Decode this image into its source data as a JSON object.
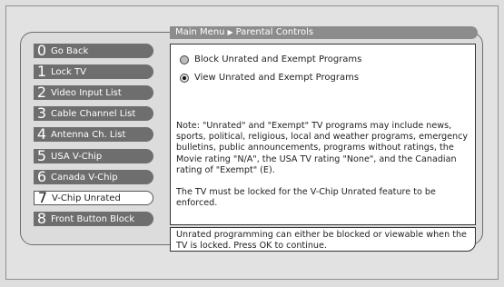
{
  "breadcrumb": {
    "parent": "Main Menu",
    "separator": "▶",
    "current": "Parental Controls"
  },
  "menu": [
    {
      "num": "0",
      "label": "Go Back",
      "selected": false
    },
    {
      "num": "1",
      "label": "Lock TV",
      "selected": false
    },
    {
      "num": "2",
      "label": "Video Input List",
      "selected": false
    },
    {
      "num": "3",
      "label": "Cable Channel List",
      "selected": false
    },
    {
      "num": "4",
      "label": "Antenna Ch. List",
      "selected": false
    },
    {
      "num": "5",
      "label": "USA V-Chip",
      "selected": false
    },
    {
      "num": "6",
      "label": "Canada V-Chip",
      "selected": false
    },
    {
      "num": "7",
      "label": "V-Chip Unrated",
      "selected": true
    },
    {
      "num": "8",
      "label": "Front Button Block",
      "selected": false
    }
  ],
  "options": [
    {
      "label": "Block Unrated and Exempt Programs",
      "checked": false
    },
    {
      "label": "View Unrated and Exempt Programs",
      "checked": true
    }
  ],
  "note": {
    "paragraph1": "Note: \"Unrated\" and \"Exempt\" TV programs may include news, sports, political, religious, local and weather programs, emergency bulletins, public announcements, programs without ratings, the Movie rating \"N/A\", the USA TV rating \"None\", and the Canadian rating of \"Exempt\" (E).",
    "paragraph2": "The TV must be locked for the V-Chip Unrated feature to be enforced."
  },
  "hint": "Unrated programming can either be blocked or viewable when the TV is locked. Press OK to continue.",
  "colors": {
    "menu_bg": "#6e6e6e",
    "crumb_bg": "#8c8c8c",
    "selected_bg": "#ffffff"
  }
}
